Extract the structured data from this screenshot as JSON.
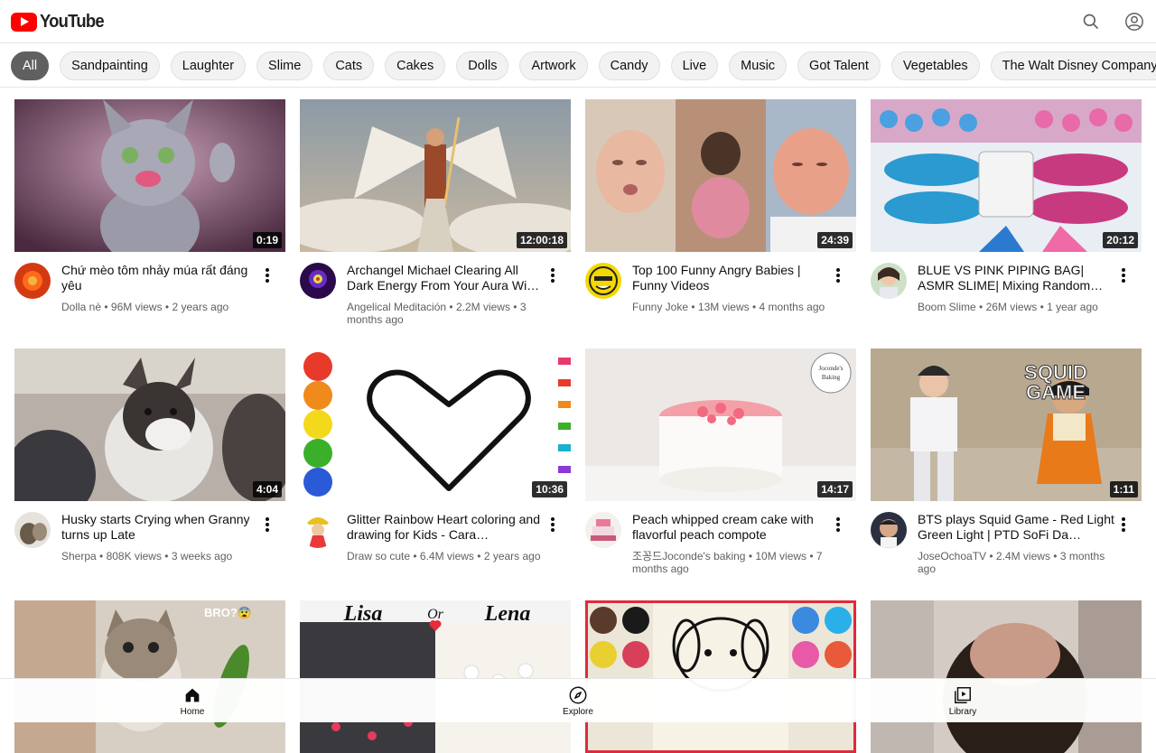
{
  "app": {
    "logo_text": "YouTube"
  },
  "header": {
    "search_icon": "search-icon",
    "account_icon": "account-icon"
  },
  "chips": [
    {
      "label": "All",
      "active": true
    },
    {
      "label": "Sandpainting"
    },
    {
      "label": "Laughter"
    },
    {
      "label": "Slime"
    },
    {
      "label": "Cats"
    },
    {
      "label": "Cakes"
    },
    {
      "label": "Dolls"
    },
    {
      "label": "Artwork"
    },
    {
      "label": "Candy"
    },
    {
      "label": "Live"
    },
    {
      "label": "Music"
    },
    {
      "label": "Got Talent"
    },
    {
      "label": "Vegetables"
    },
    {
      "label": "The Walt Disney Company"
    }
  ],
  "videos": [
    {
      "title": "Chứ mèo tôm nhảy múa rất đáng yêu",
      "channel": "Dolla nè",
      "views": "96M views",
      "age": "2 years ago",
      "duration": "0:19"
    },
    {
      "title": "Archangel Michael Clearing All Dark Energy From Your Aura Wi…",
      "channel": "Angelical Meditación",
      "views": "2.2M views",
      "age": "3 months ago",
      "duration": "12:00:18"
    },
    {
      "title": "Top 100 Funny Angry Babies | Funny Videos",
      "channel": "Funny Joke",
      "views": "13M views",
      "age": "4 months ago",
      "duration": "24:39"
    },
    {
      "title": "BLUE VS PINK PIPING BAG| ASMR SLIME| Mixing Random…",
      "channel": "Boom Slime",
      "views": "26M views",
      "age": "1 year ago",
      "duration": "20:12"
    },
    {
      "title": "Husky starts Crying when Granny turns up Late",
      "channel": "Sherpa",
      "views": "808K views",
      "age": "3 weeks ago",
      "duration": "4:04"
    },
    {
      "title": "Glitter Rainbow Heart coloring and drawing for Kids - Cara…",
      "channel": "Draw so cute",
      "views": "6.4M views",
      "age": "2 years ago",
      "duration": "10:36"
    },
    {
      "title": "Peach whipped cream cake with flavorful peach compote",
      "channel": "조꽁드Joconde's baking",
      "views": "10M views",
      "age": "7 months ago",
      "duration": "14:17"
    },
    {
      "title": "BTS plays Squid Game - Red Light Green Light | PTD SoFi Da…",
      "channel": "JoseOchoaTV",
      "views": "2.4M views",
      "age": "3 months ago",
      "duration": "1:11"
    },
    {
      "title": "",
      "channel": "",
      "views": "",
      "age": "",
      "duration": ""
    },
    {
      "title": "",
      "channel": "",
      "views": "",
      "age": "",
      "duration": ""
    },
    {
      "title": "",
      "channel": "",
      "views": "",
      "age": "",
      "duration": ""
    },
    {
      "title": "",
      "channel": "",
      "views": "",
      "age": "",
      "duration": ""
    }
  ],
  "thumb_text": {
    "v12": "BRO?😨",
    "v13_left": "Lisa",
    "v13_or": "Or",
    "v13_right": "Lena",
    "v8_brand1": "SQUID",
    "v8_brand2": "GAME",
    "v7_badge1": "Joconde's",
    "v7_badge2": "Baking"
  },
  "bottom_nav": [
    {
      "label": "Home",
      "icon": "home-icon"
    },
    {
      "label": "Explore",
      "icon": "compass-icon"
    },
    {
      "label": "Library",
      "icon": "library-icon"
    }
  ],
  "colors": {
    "brand": "#ff0000",
    "chip_active": "#606060"
  }
}
